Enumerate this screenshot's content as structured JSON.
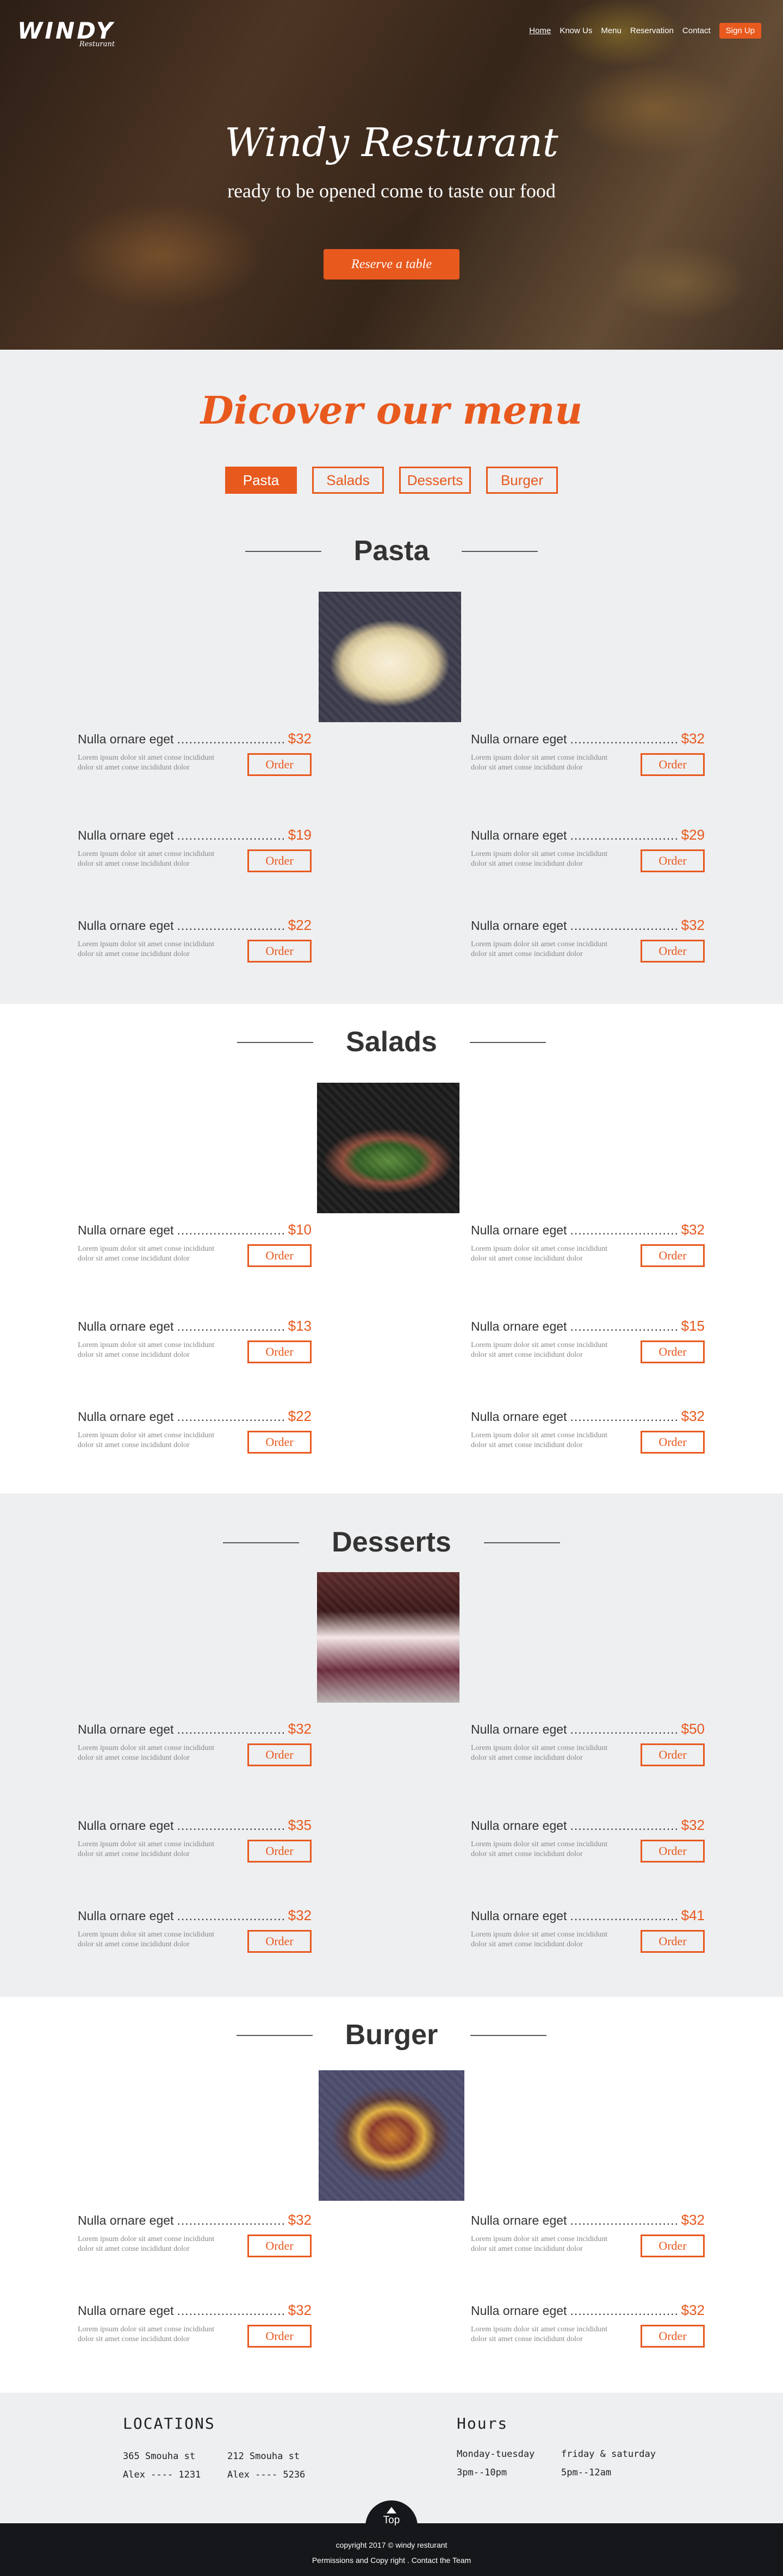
{
  "brand": {
    "name": "WINDY",
    "tagline": "Resturant"
  },
  "nav": {
    "items": [
      "Home",
      "Know Us",
      "Menu",
      "Reservation",
      "Contact"
    ],
    "signup": "Sign Up"
  },
  "hero": {
    "title": "Windy Resturant",
    "subtitle": "ready to be opened come to taste our food",
    "cta": "Reserve a table"
  },
  "menu": {
    "heading": "Dicover our menu",
    "tabs": [
      "Pasta",
      "Salads",
      "Desserts",
      "Burger"
    ],
    "order_label": "Order",
    "item_name": "Nulla ornare eget",
    "item_desc": "Lorem ipsum dolor sit amet conse incididunt dolor sit amet conse incididunt dolor",
    "categories": [
      {
        "title": "Pasta",
        "image": "pasta-photo",
        "prices": [
          "$32",
          "$32",
          "$19",
          "$29",
          "$22",
          "$32"
        ]
      },
      {
        "title": "Salads",
        "image": "salad-photo",
        "prices": [
          "$10",
          "$32",
          "$13",
          "$15",
          "$22",
          "$32"
        ]
      },
      {
        "title": "Desserts",
        "image": "dessert-photo",
        "prices": [
          "$32",
          "$50",
          "$35",
          "$32",
          "$32",
          "$41"
        ]
      },
      {
        "title": "Burger",
        "image": "burger-photo",
        "prices": [
          "$32",
          "$32",
          "$32",
          "$32"
        ]
      }
    ]
  },
  "footer": {
    "locations_title": "LOCATIONS",
    "locations": [
      {
        "street": "365 Smouha st",
        "phone": "Alex ---- 1231"
      },
      {
        "street": "212 Smouha st",
        "phone": "Alex ---- 5236"
      }
    ],
    "hours_title": "Hours",
    "hours": [
      {
        "days": "Monday-tuesday",
        "time": "3pm--10pm"
      },
      {
        "days": "friday & saturday",
        "time": "5pm--12am"
      }
    ],
    "top_label": "Top",
    "copyright": "copyright 2017 © windy resturant",
    "permissions": "Permissions and Copy right",
    "contact": "Contact the Team"
  },
  "colors": {
    "accent": "#e8591e",
    "section_gray": "#eeeff1",
    "footer_dark": "#16171a"
  }
}
